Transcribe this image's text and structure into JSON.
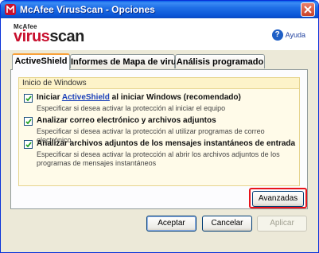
{
  "window": {
    "title": "McAfee VirusScan - Opciones"
  },
  "header": {
    "brand": "McAfee",
    "product_prefix": "virus",
    "product_suffix": "scan",
    "help_label": "Ayuda"
  },
  "tabs": [
    {
      "label": "ActiveShield",
      "active": true
    },
    {
      "label": "Informes de Mapa de virus",
      "active": false
    },
    {
      "label": "Análisis programado",
      "active": false
    }
  ],
  "group": {
    "title": "Inicio de Windows",
    "options": [
      {
        "label_pre": "Iniciar ",
        "label_link": "ActiveShield",
        "label_post": " al iniciar Windows (recomendado)",
        "description": "Especificar si desea activar la protección al iniciar el equipo",
        "checked": true
      },
      {
        "label": "Analizar correo electrónico y archivos adjuntos",
        "description": "Especificar si desea activar la protección al utilizar programas de correo electrónico",
        "checked": true
      },
      {
        "label": "Analizar archivos adjuntos de los mensajes instantáneos de entrada",
        "description": "Especificar si desea activar la protección al abrir los archivos adjuntos de los programas de mensajes instantáneos",
        "checked": true
      }
    ]
  },
  "buttons": {
    "advanced": "Avanzadas",
    "accept": "Aceptar",
    "cancel": "Cancelar",
    "apply": "Aplicar"
  },
  "colors": {
    "titlebar": "#0a55d6",
    "highlight": "#e8141c",
    "tab_accent": "#f9a23b",
    "group_bg": "#fffbe9"
  }
}
